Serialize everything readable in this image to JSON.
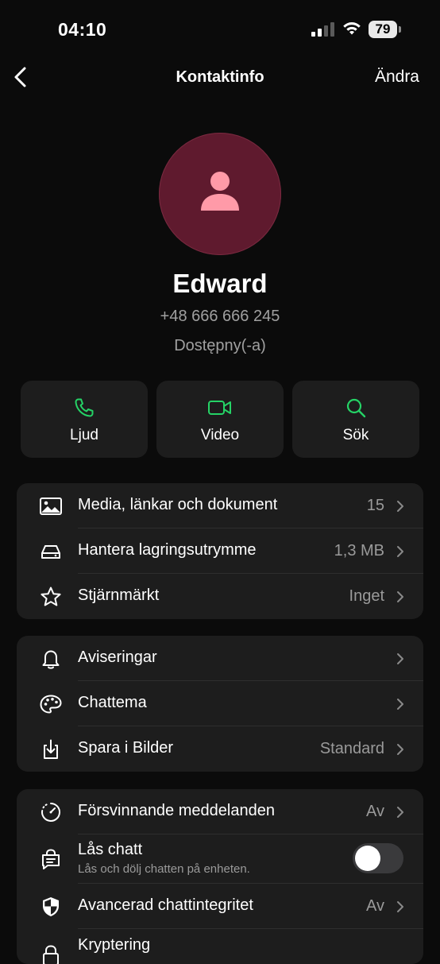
{
  "status_bar": {
    "time": "04:10",
    "battery": "79"
  },
  "nav": {
    "title": "Kontaktinfo",
    "edit_label": "Ändra"
  },
  "contact": {
    "name": "Edward",
    "phone": "+48 666 666 245",
    "status": "Dostępny(-a)"
  },
  "actions": [
    {
      "label": "Ljud",
      "icon": "phone-icon"
    },
    {
      "label": "Video",
      "icon": "video-icon"
    },
    {
      "label": "Sök",
      "icon": "search-icon"
    }
  ],
  "group1": [
    {
      "label": "Media, länkar och dokument",
      "value": "15",
      "icon": "image-icon"
    },
    {
      "label": "Hantera lagringsutrymme",
      "value": "1,3 MB",
      "icon": "storage-icon"
    },
    {
      "label": "Stjärnmärkt",
      "value": "Inget",
      "icon": "star-icon"
    }
  ],
  "group2": [
    {
      "label": "Aviseringar",
      "value": "",
      "icon": "bell-icon"
    },
    {
      "label": "Chattema",
      "value": "",
      "icon": "palette-icon"
    },
    {
      "label": "Spara i Bilder",
      "value": "Standard",
      "icon": "save-download-icon"
    }
  ],
  "group3": {
    "disappearing": {
      "label": "Försvinnande meddelanden",
      "value": "Av",
      "icon": "timer-icon"
    },
    "lock_chat": {
      "label": "Lås chatt",
      "sublabel": "Lås och dölj chatten på enheten.",
      "toggle_on": false,
      "icon": "lock-chat-icon"
    },
    "advanced_privacy": {
      "label": "Avancerad chattintegritet",
      "value": "Av",
      "icon": "shield-icon"
    },
    "encryption": {
      "label": "Kryptering",
      "icon": "lock-icon"
    }
  },
  "colors": {
    "background": "#0b0b0b",
    "card": "#1d1d1d",
    "accent_green": "#25d366",
    "avatar_bg": "#5f1a2e",
    "avatar_fg": "#ff9aa8"
  }
}
